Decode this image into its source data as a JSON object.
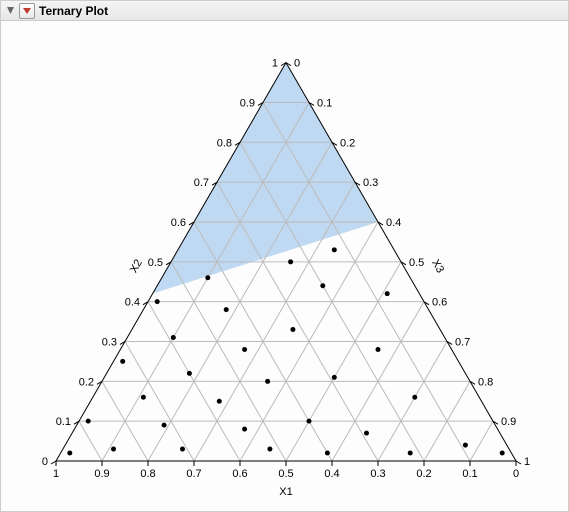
{
  "header": {
    "title": "Ternary Plot"
  },
  "chart_data": {
    "type": "ternary",
    "axes": {
      "bottom": {
        "label": "X1",
        "ticks": [
          1,
          0.9,
          0.8,
          0.7,
          0.6,
          0.5,
          0.4,
          0.3,
          0.2,
          0.1,
          0
        ]
      },
      "left": {
        "label": "X2",
        "ticks": [
          0,
          0.1,
          0.2,
          0.3,
          0.4,
          0.5,
          0.6,
          0.7,
          0.8,
          0.9,
          1
        ]
      },
      "right": {
        "label": "X3",
        "ticks": [
          0,
          0.1,
          0.2,
          0.3,
          0.4,
          0.5,
          0.6,
          0.7,
          0.8,
          0.9,
          1
        ]
      }
    },
    "shaded_region_comment": "upper region with X2 >= approx 0.42 on left decreasing to X2 >= approx 0.6 on right, above a near-straight boundary",
    "shaded_polygon_bc": [
      {
        "b": 1.0,
        "c": 0.0
      },
      {
        "b": 0.6,
        "c": 0.4
      },
      {
        "b": 0.42,
        "c": 0.0
      }
    ],
    "points_bc": [
      {
        "b": 0.02,
        "c": 0.02
      },
      {
        "b": 0.1,
        "c": 0.02
      },
      {
        "b": 0.03,
        "c": 0.11
      },
      {
        "b": 0.16,
        "c": 0.11
      },
      {
        "b": 0.25,
        "c": 0.02
      },
      {
        "b": 0.22,
        "c": 0.18
      },
      {
        "b": 0.09,
        "c": 0.19
      },
      {
        "b": 0.31,
        "c": 0.1
      },
      {
        "b": 0.03,
        "c": 0.26
      },
      {
        "b": 0.15,
        "c": 0.28
      },
      {
        "b": 0.4,
        "c": 0.02
      },
      {
        "b": 0.38,
        "c": 0.18
      },
      {
        "b": 0.28,
        "c": 0.27
      },
      {
        "b": 0.08,
        "c": 0.37
      },
      {
        "b": 0.03,
        "c": 0.45
      },
      {
        "b": 0.2,
        "c": 0.36
      },
      {
        "b": 0.46,
        "c": 0.1
      },
      {
        "b": 0.33,
        "c": 0.35
      },
      {
        "b": 0.5,
        "c": 0.26
      },
      {
        "b": 0.1,
        "c": 0.5
      },
      {
        "b": 0.02,
        "c": 0.58
      },
      {
        "b": 0.53,
        "c": 0.34
      },
      {
        "b": 0.44,
        "c": 0.36
      },
      {
        "b": 0.21,
        "c": 0.5
      },
      {
        "b": 0.07,
        "c": 0.64
      },
      {
        "b": 0.28,
        "c": 0.56
      },
      {
        "b": 0.02,
        "c": 0.76
      },
      {
        "b": 0.42,
        "c": 0.51
      },
      {
        "b": 0.16,
        "c": 0.7
      },
      {
        "b": 0.04,
        "c": 0.87
      },
      {
        "b": 0.02,
        "c": 0.96
      }
    ],
    "marker": {
      "shape": "circle",
      "color": "#000",
      "radius_px": 2.5
    },
    "shaded_fill": "#bfd9f2"
  }
}
